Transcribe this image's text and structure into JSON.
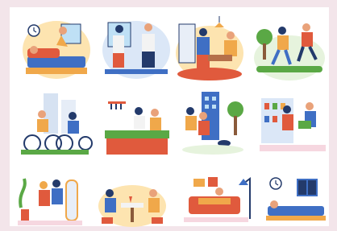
{
  "image": {
    "type": "illustration-grid",
    "rows": 3,
    "columns": 4,
    "scenes": [
      {
        "id": "waking-up-bed",
        "icon": "clock-icon"
      },
      {
        "id": "getting-dressed",
        "icon": "window-icon"
      },
      {
        "id": "cooking-kitchen",
        "icon": "lamp-icon"
      },
      {
        "id": "jogging-park",
        "icon": "tree-icon"
      },
      {
        "id": "cycling-city",
        "icon": "bicycle-icon"
      },
      {
        "id": "cooking-together",
        "icon": "pan-icon"
      },
      {
        "id": "walking-dog",
        "icon": "building-icon"
      },
      {
        "id": "grocery-shopping",
        "icon": "shelf-icon"
      },
      {
        "id": "mirror-outfit",
        "icon": "mirror-icon"
      },
      {
        "id": "dinner-date",
        "icon": "wine-icon"
      },
      {
        "id": "couch-relaxing",
        "icon": "sofa-icon"
      },
      {
        "id": "sleeping-night",
        "icon": "clock-icon"
      }
    ],
    "colors": {
      "background": "#ffffff",
      "border": "#f3e5ea",
      "orange": "#f0a84a",
      "blue": "#3f6fc4",
      "red": "#e05a3d",
      "green": "#5aa845",
      "skin": "#e9a27a",
      "dark": "#233a6b"
    }
  }
}
